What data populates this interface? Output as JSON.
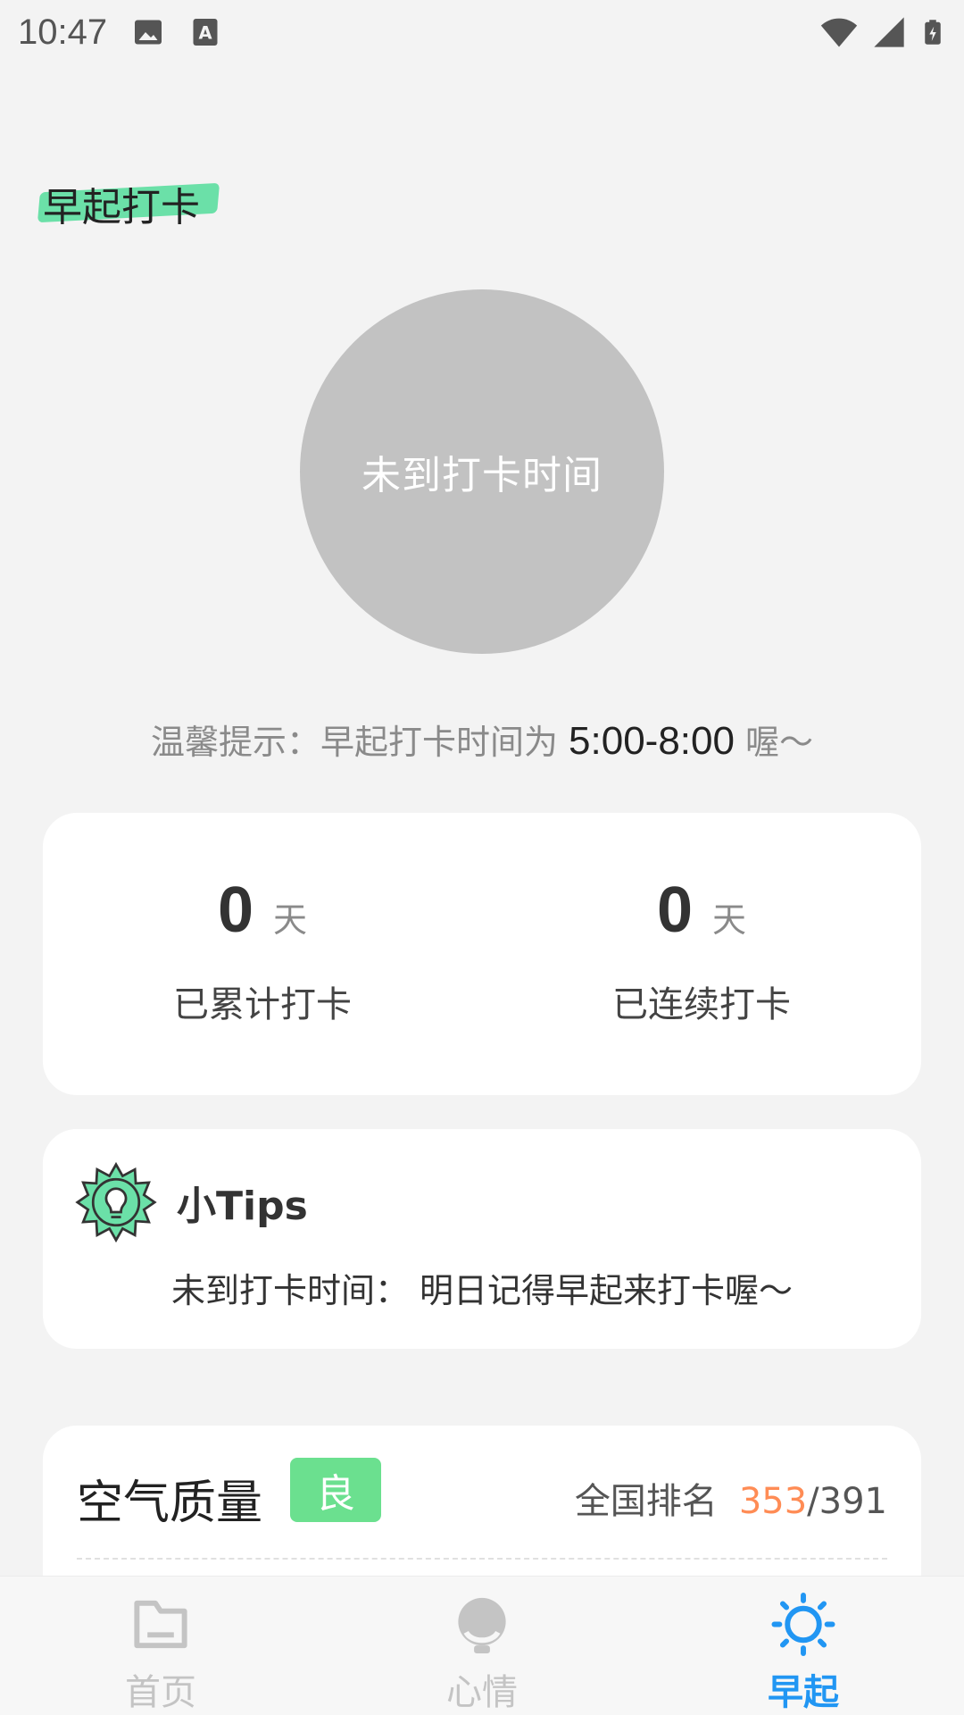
{
  "status_bar": {
    "time": "10:47",
    "icons": [
      "image-icon",
      "a-icon",
      "wifi-icon",
      "cell-signal-icon",
      "battery-charging-icon"
    ]
  },
  "page": {
    "title": "早起打卡"
  },
  "punch": {
    "label": "未到打卡时间"
  },
  "hint": {
    "prefix": "温馨提示：早起打卡时间为 ",
    "time_range": "5:00-8:00",
    "suffix": " 喔～"
  },
  "stats": {
    "total": {
      "value": "0",
      "unit": "天",
      "label": "已累计打卡"
    },
    "streak": {
      "value": "0",
      "unit": "天",
      "label": "已连续打卡"
    }
  },
  "tips": {
    "title": "小Tips",
    "text": "未到打卡时间： 明日记得早起来打卡喔～"
  },
  "air": {
    "title": "空气质量",
    "badge": "良",
    "rank_label": "全国排名",
    "rank_value": "353",
    "rank_total": "/391"
  },
  "bottom_nav": {
    "home": "首页",
    "mood": "心情",
    "early": "早起"
  },
  "colors": {
    "accent": "#2196f3",
    "highlight": "#6be0a8",
    "badge": "#6be08f",
    "rank": "#ff8c55"
  }
}
